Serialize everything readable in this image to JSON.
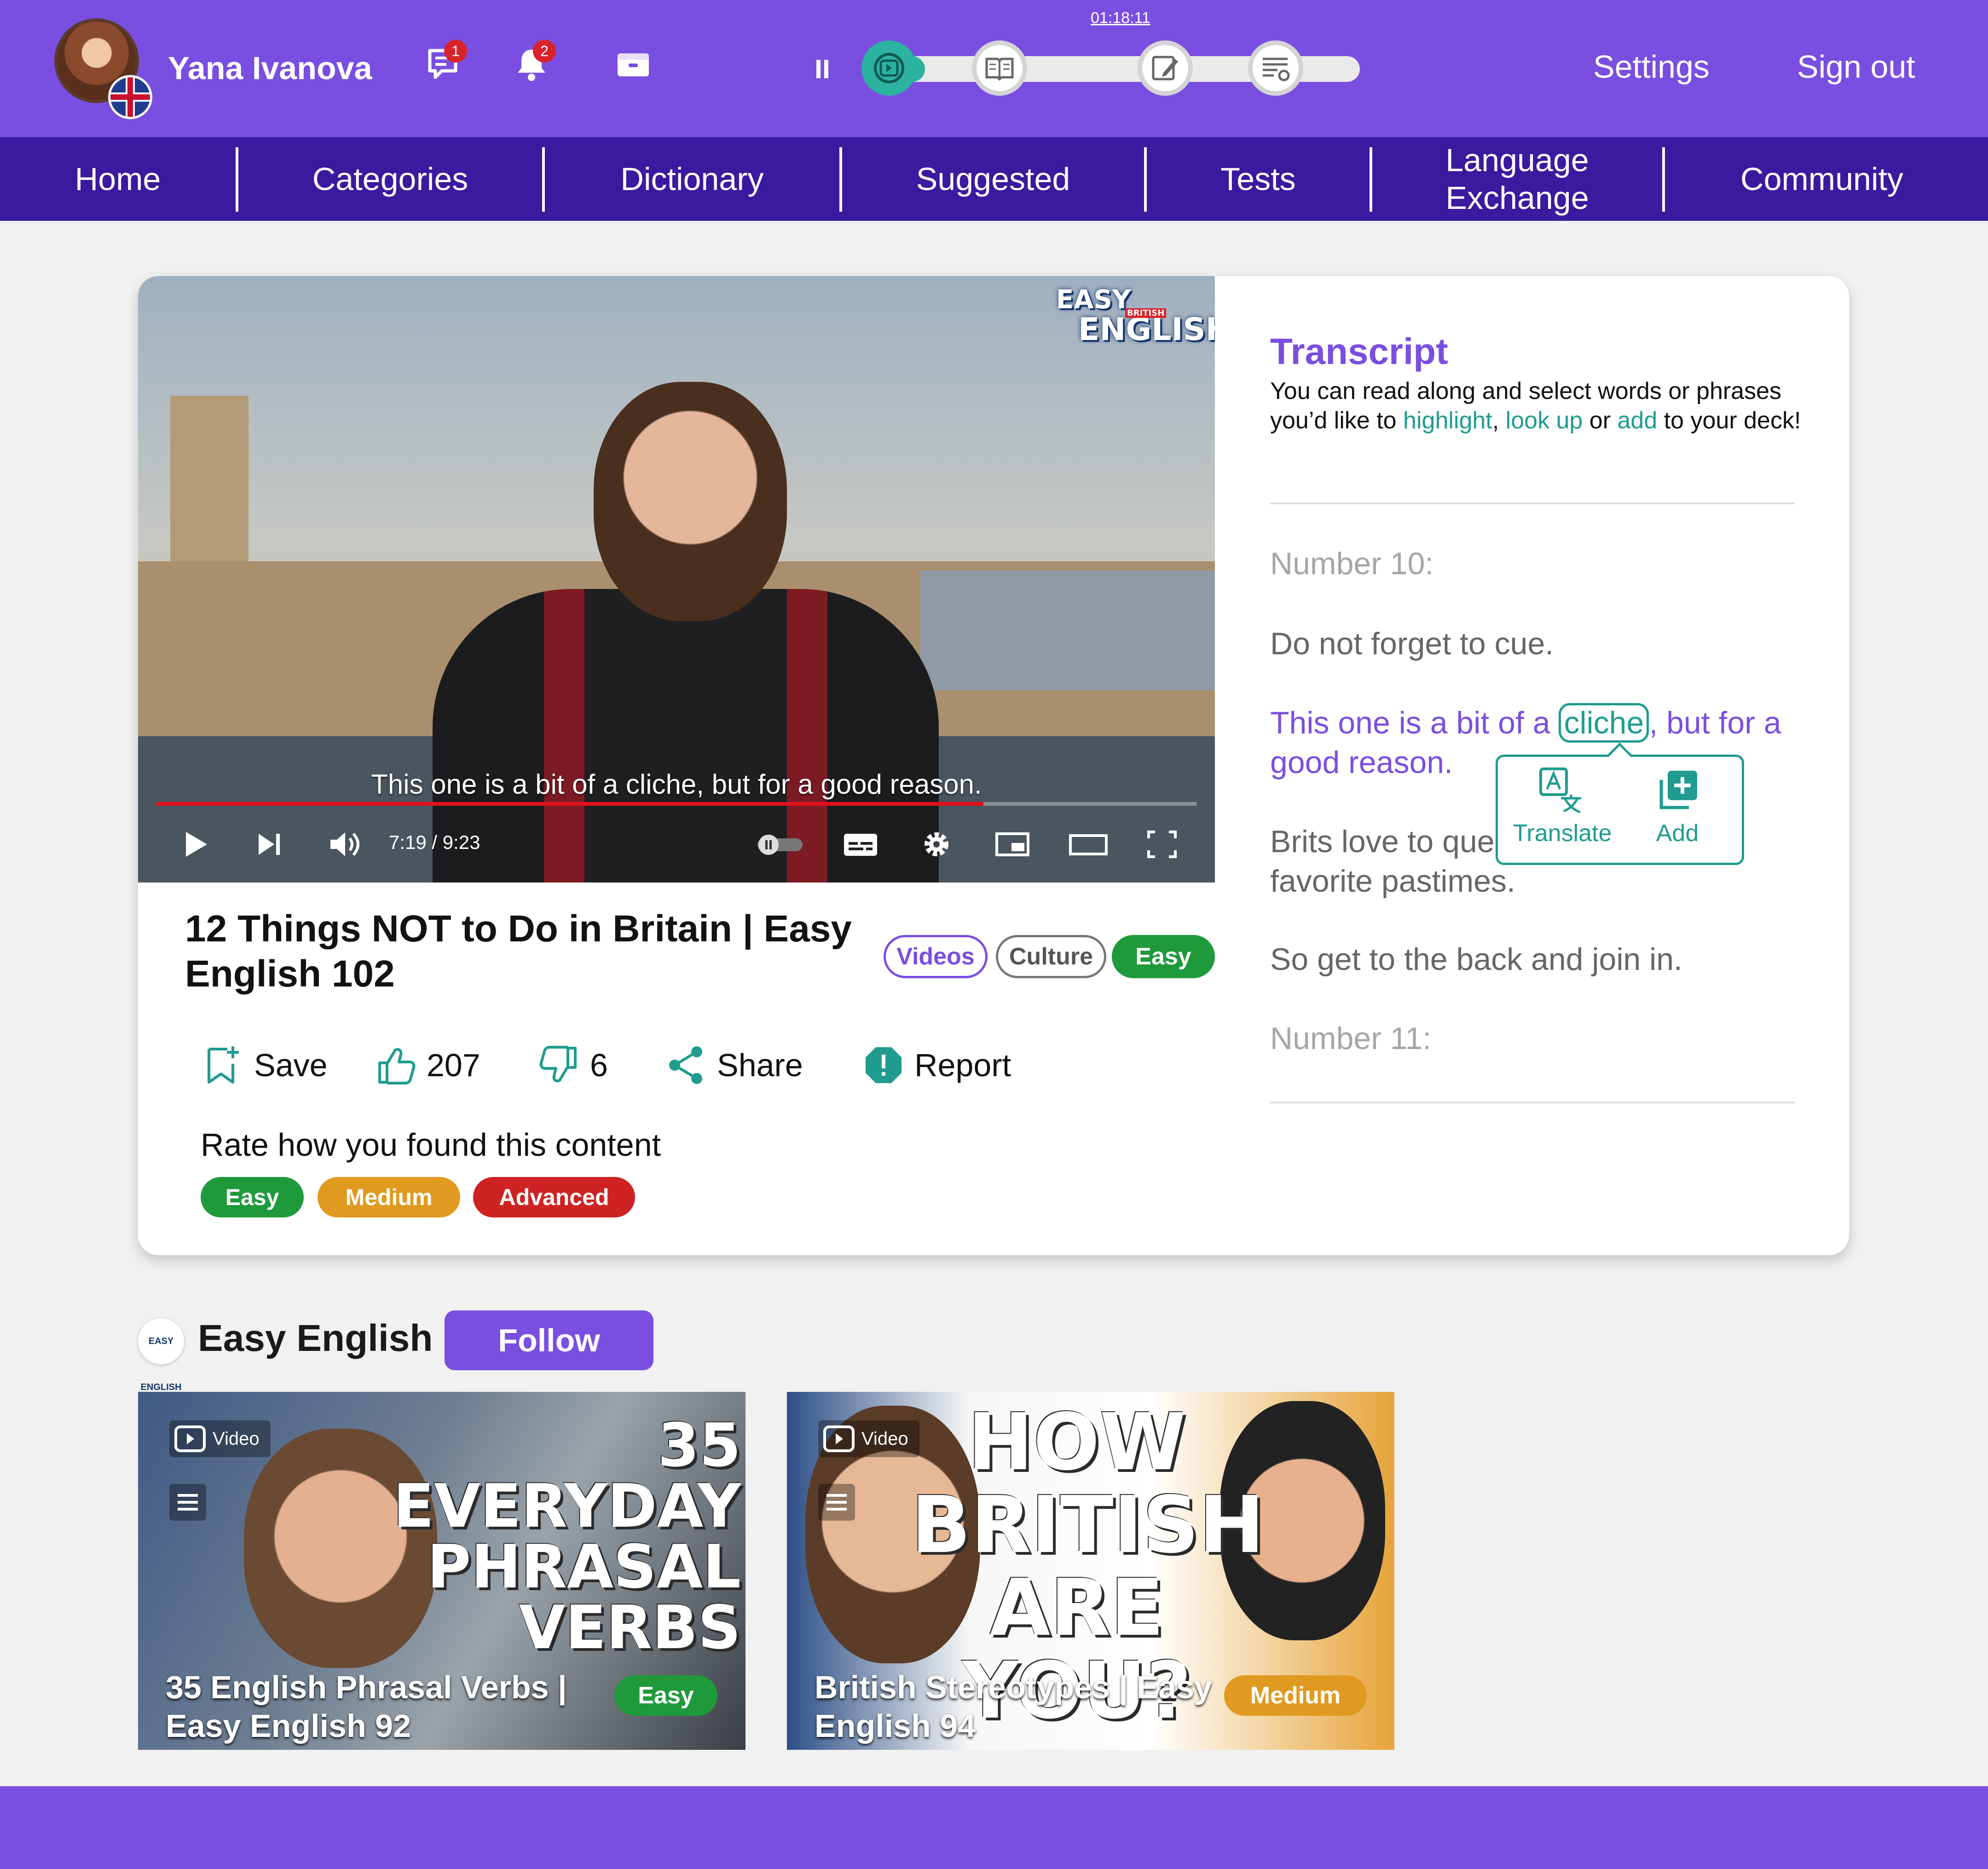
{
  "header": {
    "user_name": "Yana Ivanova",
    "messages_badge": "1",
    "notifications_badge": "2",
    "session_timer": "01:18:11",
    "learning_progress": 0.06,
    "settings_label": "Settings",
    "signout_label": "Sign out"
  },
  "nav": {
    "items": [
      "Home",
      "Categories",
      "Dictionary",
      "Suggested",
      "Tests",
      "Language Exchange",
      "Community"
    ]
  },
  "video": {
    "channel_watermark_top": "EASY",
    "channel_watermark_small": "BRITISH",
    "channel_watermark_bottom": "ENGLISH",
    "caption": "This one is a bit of a cliche, but for a good reason.",
    "time_display": "7:19 / 9:23",
    "played_fraction": 0.795,
    "title": "12 Things NOT to Do in Britain | Easy English 102",
    "tags": [
      "Videos",
      "Culture",
      "Easy"
    ],
    "actions": {
      "save": "Save",
      "likes": "207",
      "dislikes": "6",
      "share": "Share",
      "report": "Report"
    },
    "rate_label": "Rate how you found this content",
    "rate_options": [
      "Easy",
      "Medium",
      "Advanced"
    ]
  },
  "transcript": {
    "title": "Transcript",
    "desc_part1": "You can read along and select words or phrases you’d like to ",
    "desc_highlight": "highlight",
    "desc_sep1": ", ",
    "desc_lookup": "look up",
    "desc_sep2": " or ",
    "desc_add": "add",
    "desc_part2": " to your deck!",
    "line_number10": "Number 10:",
    "line_cue": "Do not forget to cue.",
    "line_cliche_before": "This one is a bit of a ",
    "line_cliche_word": "cliche",
    "line_cliche_after": ", but for a good reason.",
    "line_brits": "Brits love to queue, it's one of our favorite pastimes.",
    "line_back": "So get to the back and join in.",
    "line_number11": "Number 11:",
    "popup_translate": "Translate",
    "popup_add": "Add"
  },
  "channel": {
    "logo_text": "EASY ENGLISH",
    "name": "Easy English",
    "follow_label": "Follow"
  },
  "related": [
    {
      "chip": "Video",
      "thumb_text": [
        "35",
        "EVERYDAY",
        "PHRASAL",
        "VERBS"
      ],
      "title": "35 English Phrasal Verbs | Easy English 92",
      "level": "Easy"
    },
    {
      "chip": "Video",
      "thumb_text": [
        "HOW",
        "BRITISH",
        "ARE YOU?"
      ],
      "title": "British Stereotypes | Easy English 94",
      "level": "Medium"
    }
  ],
  "colors": {
    "brand_purple": "#7a4ee0",
    "nav_indigo": "#3a1a9e",
    "teal": "#1f9c8f",
    "easy_green": "#1e9a3a",
    "medium_orange": "#e09a1f",
    "advanced_red": "#cf2323"
  },
  "icons": {
    "messages": "chat-icon",
    "notifications": "bell-icon",
    "inbox": "inbox-icon",
    "steps": [
      "video-step-icon",
      "read-step-icon",
      "write-step-icon",
      "review-step-icon"
    ]
  }
}
